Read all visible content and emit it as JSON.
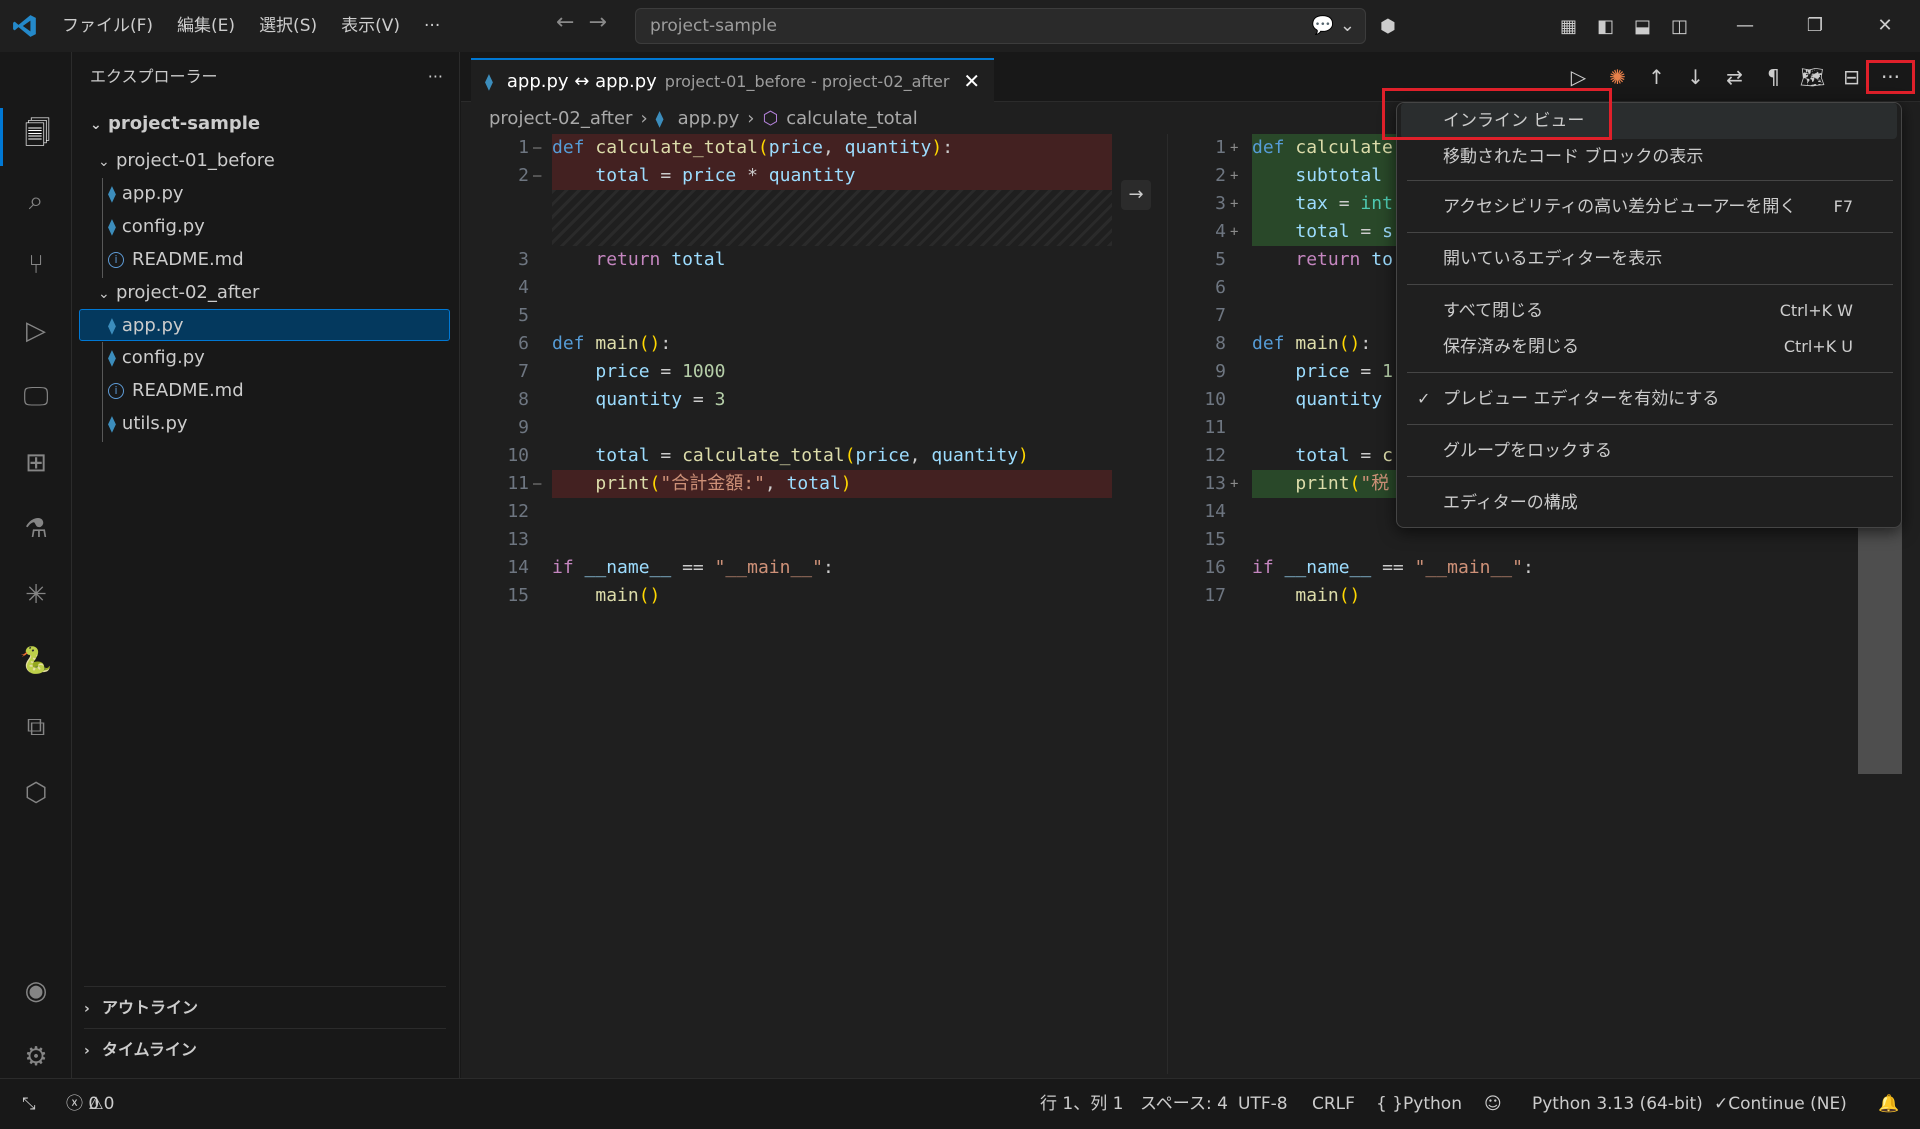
{
  "titlebar": {
    "menu": [
      "ファイル(F)",
      "編集(E)",
      "選択(S)",
      "表示(V)",
      "···"
    ],
    "search_text": "project-sample"
  },
  "sidebar": {
    "title": "エクスプローラー",
    "more": "···",
    "root": "project-sample",
    "folder1": "project-01_before",
    "folder1_files": [
      "app.py",
      "config.py",
      "README.md"
    ],
    "folder2": "project-02_after",
    "folder2_files": [
      "app.py",
      "config.py",
      "README.md",
      "utils.py"
    ],
    "outline": "アウトライン",
    "timeline": "タイムライン"
  },
  "editor": {
    "tab_title": "app.py ↔ app.py",
    "tab_desc": "project-01_before - project-02_after",
    "breadcrumb": [
      "project-02_after",
      "app.py",
      "calculate_total"
    ]
  },
  "left_lines": [
    "1",
    "2",
    "3",
    "4",
    "5",
    "6",
    "7",
    "8",
    "9",
    "10",
    "11",
    "12",
    "13",
    "14",
    "15"
  ],
  "right_lines": [
    "1",
    "2",
    "3",
    "4",
    "5",
    "6",
    "7",
    "8",
    "9",
    "10",
    "11",
    "12",
    "13",
    "14",
    "15",
    "16",
    "17"
  ],
  "context_menu": {
    "items": [
      {
        "label": "インライン ビュー",
        "shortcut": ""
      },
      {
        "label": "移動されたコード ブロックの表示",
        "shortcut": ""
      },
      {
        "label": "アクセシビリティの高い差分ビューアーを開く",
        "shortcut": "F7"
      },
      {
        "label": "開いているエディターを表示",
        "shortcut": ""
      },
      {
        "label": "すべて閉じる",
        "shortcut": "Ctrl+K W"
      },
      {
        "label": "保存済みを閉じる",
        "shortcut": "Ctrl+K U"
      },
      {
        "label": "プレビュー エディターを有効にする",
        "shortcut": ""
      },
      {
        "label": "グループをロックする",
        "shortcut": ""
      },
      {
        "label": "エディターの構成",
        "shortcut": ""
      }
    ],
    "checked": "✓"
  },
  "statusbar": {
    "errors": "0",
    "warnings": "0",
    "position": "行 1、列 1",
    "spaces": "スペース: 4",
    "encoding": "UTF-8",
    "eol": "CRLF",
    "language": "Python",
    "interpreter": "Python 3.13 (64-bit)",
    "continue": "Continue (NE)"
  }
}
